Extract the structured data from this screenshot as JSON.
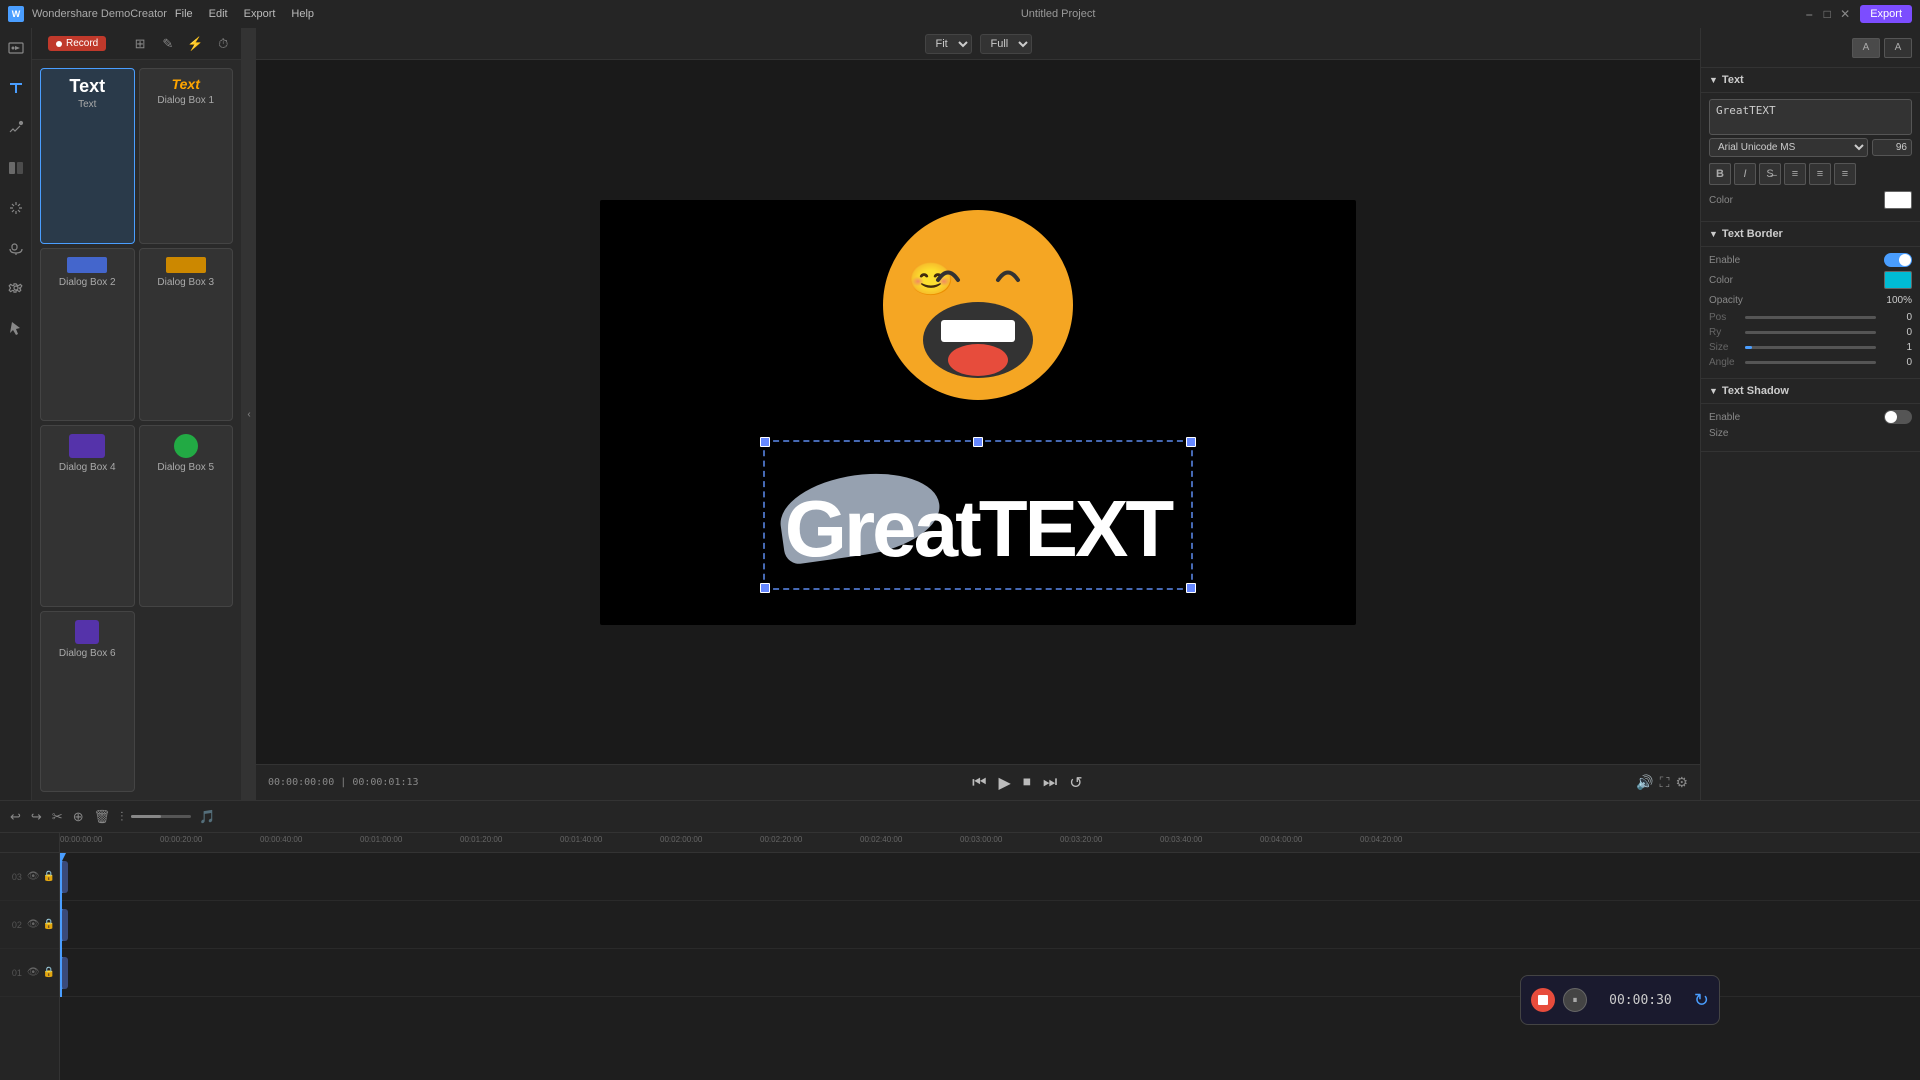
{
  "app": {
    "brand": "Wondershare DemoCreator",
    "title": "Untitled Project",
    "export_label": "Export",
    "record_label": "Record"
  },
  "menus": {
    "items": [
      "File",
      "Edit",
      "Export",
      "Help"
    ]
  },
  "preview": {
    "fit_label": "Fit",
    "quality_label": "Full",
    "canvas_text": "GreatTEXT",
    "time_current": "00:00:00:00",
    "time_total": "00:00:01:13"
  },
  "text_panel": {
    "items": [
      {
        "id": "text",
        "label": "Text",
        "style": "plain"
      },
      {
        "id": "dialog1",
        "label": "Dialog Box 1",
        "style": "orange"
      },
      {
        "id": "dialog2",
        "label": "Dialog Box 2",
        "style": "blue-bar"
      },
      {
        "id": "dialog3",
        "label": "Dialog Box 3",
        "style": "yellow-bar"
      },
      {
        "id": "dialog4",
        "label": "Dialog Box 4",
        "style": "purple-box"
      },
      {
        "id": "dialog5",
        "label": "Dialog Box 5",
        "style": "green-circle"
      },
      {
        "id": "dialog6",
        "label": "Dialog Box 6",
        "style": "purple-small"
      }
    ]
  },
  "right_panel": {
    "text_section": {
      "title": "Text",
      "input_value": "GreatTEXT",
      "font": "Arial Unicode MS",
      "font_size": "96",
      "format_btns": [
        "B",
        "I",
        "S",
        "≡",
        "≡",
        "≡"
      ],
      "color_label": "Color"
    },
    "text_border": {
      "title": "Text Border",
      "enable_label": "Enable",
      "enabled": true,
      "color_label": "Color",
      "color": "#00bcd4",
      "opacity_label": "Opacity",
      "opacity_value": "100%",
      "pos_label": "Pos",
      "pos_value": "0",
      "ry_label": "Ry",
      "ry_value": "0",
      "size_label": "Size",
      "size_value": "1",
      "angle_label": "Angle",
      "angle_value": "0"
    },
    "text_shadow": {
      "title": "Text Shadow",
      "enable_label": "Enable",
      "enabled": false,
      "size_label": "Size"
    }
  },
  "timeline": {
    "tracks": [
      {
        "num": "03",
        "locked": true
      },
      {
        "num": "02",
        "locked": true
      },
      {
        "num": "01",
        "locked": true
      }
    ],
    "ruler_marks": [
      "00:00:00:00",
      "00:00:20:00",
      "00:00:40:00",
      "00:01:00:00",
      "00:01:20:00",
      "00:01:40:00",
      "00:02:00:00",
      "00:02:20:00",
      "00:02:40:00",
      "00:03:00:00",
      "00:03:20:00",
      "00:03:40:00",
      "00:04:00:00",
      "00:04:20:00"
    ]
  },
  "recording": {
    "time": "00:00:30"
  }
}
